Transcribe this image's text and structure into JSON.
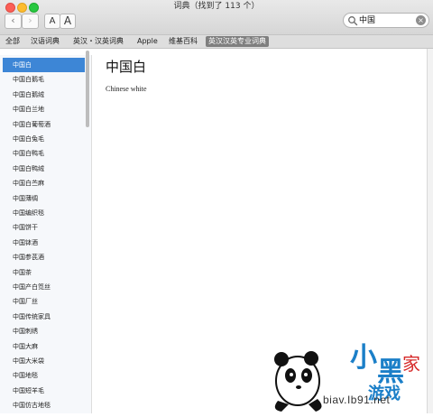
{
  "window": {
    "title": "词典（找到了 113 个）"
  },
  "toolbar": {
    "back_glyph": "‹",
    "forward_glyph": "›",
    "font_small_label": "A",
    "font_large_label": "A"
  },
  "search": {
    "value": "中国",
    "icon": "search-icon",
    "clear_glyph": "×"
  },
  "tabs": [
    {
      "label": "全部",
      "active": false
    },
    {
      "label": "汉语词典",
      "active": false
    },
    {
      "label": "英汉・汉英词典",
      "active": false
    },
    {
      "label": "Apple",
      "active": false
    },
    {
      "label": "维基百科",
      "active": false
    },
    {
      "label": "英汉汉英专业词典",
      "active": true
    }
  ],
  "results": [
    {
      "label": "中国白",
      "selected": true
    },
    {
      "label": "中国白鹅毛"
    },
    {
      "label": "中国白鹅绒"
    },
    {
      "label": "中国白兰地"
    },
    {
      "label": "中国白葡萄酒"
    },
    {
      "label": "中国白兔毛"
    },
    {
      "label": "中国白鸭毛"
    },
    {
      "label": "中国白鸭绒"
    },
    {
      "label": "中国白苎麻"
    },
    {
      "label": "中国薄绸"
    },
    {
      "label": "中国编织毯"
    },
    {
      "label": "中国饼干"
    },
    {
      "label": "中国钵酒"
    },
    {
      "label": "中国参芪酒"
    },
    {
      "label": "中国茶"
    },
    {
      "label": "中国产白笕丝"
    },
    {
      "label": "中国厂丝"
    },
    {
      "label": "中国传统家具"
    },
    {
      "label": "中国刺绣"
    },
    {
      "label": "中国大麻"
    },
    {
      "label": "中国大米袋"
    },
    {
      "label": "中国地毯"
    },
    {
      "label": "中国短羊毛"
    },
    {
      "label": "中国仿古地毯"
    }
  ],
  "entry": {
    "headword": "中国白",
    "definition": "Chinese white"
  },
  "watermark": {
    "domain": "biav.Ib91.net"
  }
}
